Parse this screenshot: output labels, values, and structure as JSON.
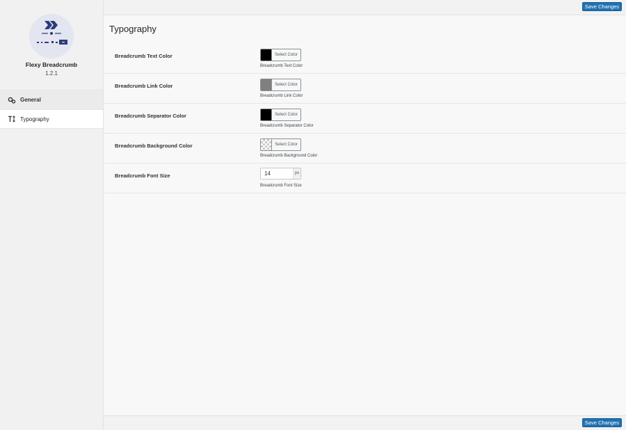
{
  "plugin": {
    "name": "Flexy Breadcrumb",
    "version": "1.2.1"
  },
  "nav": {
    "items": [
      {
        "label": "General",
        "icon": "gears-icon"
      },
      {
        "label": "Typography",
        "icon": "text-size-icon",
        "active": true
      }
    ]
  },
  "toolbar": {
    "save_label": "Save Changes"
  },
  "page": {
    "title": "Typography"
  },
  "fields": [
    {
      "label": "Breadcrumb Text Color",
      "button": "Select Color",
      "help": "Breadcrumb Text Color",
      "color": "#000000"
    },
    {
      "label": "Breadcrumb Link Color",
      "button": "Select Color",
      "help": "Breadcrumb Link Color",
      "color": "#808080"
    },
    {
      "label": "Breadcrumb Separator Color",
      "button": "Select Color",
      "help": "Breadcrumb Separator Color",
      "color": "#000000"
    },
    {
      "label": "Breadcrumb Background Color",
      "button": "Select Color",
      "help": "Breadcrumb Background Color",
      "color": "transparent"
    },
    {
      "label": "Breadcrumb Font Size",
      "value": "14",
      "unit": "px",
      "help": "Breadcrumb Font Size"
    }
  ],
  "colors": {
    "accent": "#2271b1",
    "logo_navy": "#2b3a7a"
  }
}
